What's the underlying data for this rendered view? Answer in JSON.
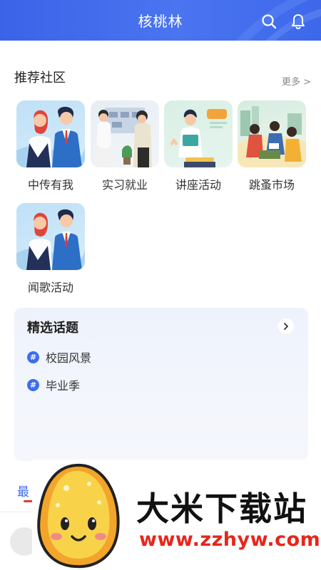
{
  "header": {
    "title": "核桃林",
    "icons": [
      "search-icon",
      "bell-icon"
    ],
    "color": "#4a74f0"
  },
  "section": {
    "title": "推荐社区",
    "more_label": "更多 >"
  },
  "communities": [
    {
      "label": "中传有我"
    },
    {
      "label": "实习就业"
    },
    {
      "label": "讲座活动"
    },
    {
      "label": "跳蚤市场"
    },
    {
      "label": "闻歌活动"
    }
  ],
  "topics": {
    "title": "精选话题",
    "items": [
      {
        "hash": "#",
        "label": "校园风景"
      },
      {
        "hash": "#",
        "label": "毕业季"
      }
    ]
  },
  "recent": {
    "label": "最"
  },
  "watermark": {
    "title": "大米下载站",
    "url": "www.zzhyw.com"
  },
  "colors": {
    "accent": "#3d6cf0",
    "watermark_red": "#e8261b"
  }
}
